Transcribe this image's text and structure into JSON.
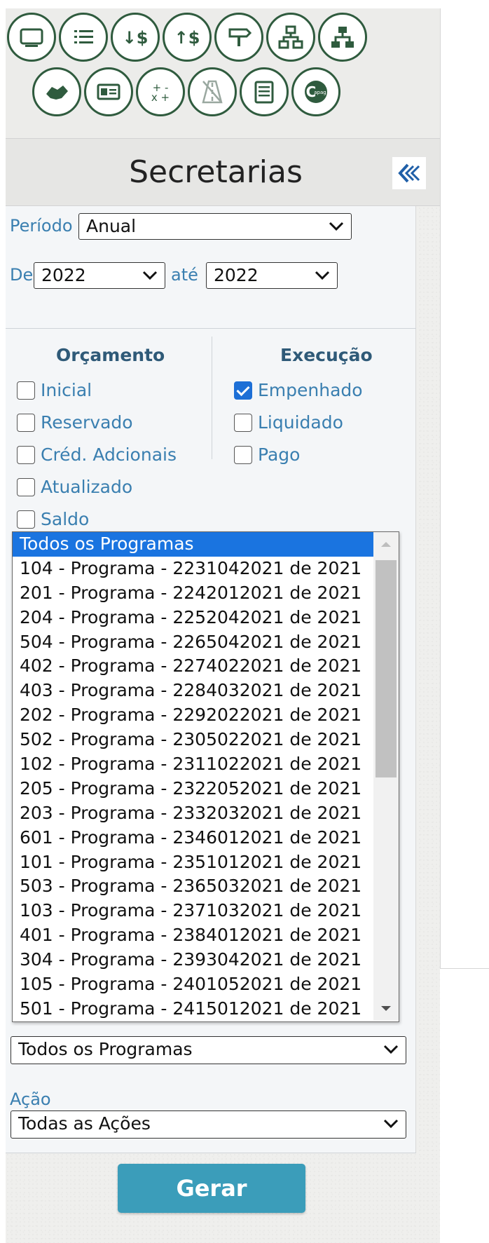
{
  "header": {
    "title": "Secretarias",
    "icons_row1": [
      "monitor-icon",
      "list-icon",
      "down-dollar-icon",
      "up-dollar-icon",
      "signpost-icon",
      "org-chart-icon",
      "org-chart-filled-icon"
    ],
    "icons_row2": [
      "handshake-icon",
      "id-card-icon",
      "math-operators-icon",
      "road-icon",
      "notepad-icon",
      "capag-icon"
    ],
    "capag_text": "apag",
    "capag_letter": "C"
  },
  "periodo": {
    "label": "Período",
    "value": "Anual"
  },
  "intervalo": {
    "de_label": "De",
    "de_value": "2022",
    "ate_label": "até",
    "ate_value": "2022"
  },
  "orcamento": {
    "title": "Orçamento",
    "items": [
      {
        "label": "Inicial",
        "checked": false
      },
      {
        "label": "Reservado",
        "checked": false
      },
      {
        "label": "Créd. Adcionais",
        "checked": false
      },
      {
        "label": "Atualizado",
        "checked": false
      },
      {
        "label": "Saldo",
        "checked": false
      }
    ]
  },
  "execucao": {
    "title": "Execução",
    "items": [
      {
        "label": "Empenhado",
        "checked": true
      },
      {
        "label": "Liquidado",
        "checked": false
      },
      {
        "label": "Pago",
        "checked": false
      }
    ]
  },
  "programa_dropdown": {
    "selected": "Todos os Programas",
    "options": [
      "Todos os Programas",
      "104 - Programa - 2231042021 de 2021",
      "201 - Programa - 2242012021 de 2021",
      "204 - Programa - 2252042021 de 2021",
      "504 - Programa - 2265042021 de 2021",
      "402 - Programa - 2274022021 de 2021",
      "403 - Programa - 2284032021 de 2021",
      "202 - Programa - 2292022021 de 2021",
      "502 - Programa - 2305022021 de 2021",
      "102 - Programa - 2311022021 de 2021",
      "205 - Programa - 2322052021 de 2021",
      "203 - Programa - 2332032021 de 2021",
      "601 - Programa - 2346012021 de 2021",
      "101 - Programa - 2351012021 de 2021",
      "503 - Programa - 2365032021 de 2021",
      "103 - Programa - 2371032021 de 2021",
      "401 - Programa - 2384012021 de 2021",
      "304 - Programa - 2393042021 de 2021",
      "105 - Programa - 2401052021 de 2021",
      "501 - Programa - 2415012021 de 2021"
    ]
  },
  "acao": {
    "label": "Ação",
    "value": "Todas as Ações"
  },
  "gerar_label": "Gerar",
  "colors": {
    "icon_green": "#2f5b3e",
    "accent_blue": "#3a7fb0",
    "button": "#3b9dba",
    "highlight": "#1a74e0"
  }
}
